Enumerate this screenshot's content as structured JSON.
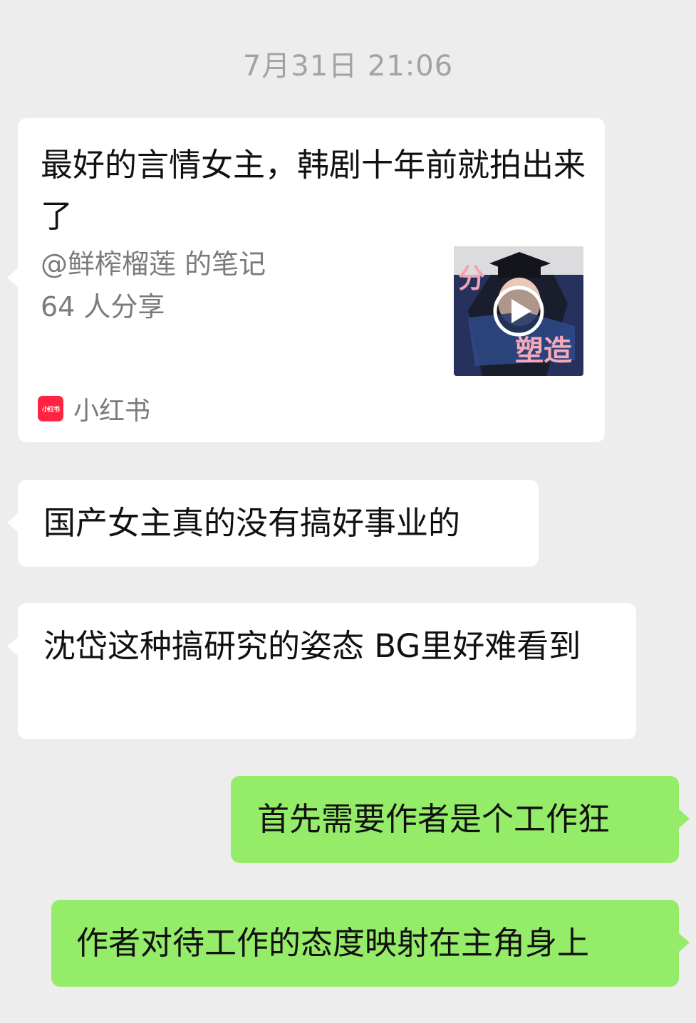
{
  "timestamp": "7月31日 21:06",
  "card": {
    "title": "最好的言情女主，韩剧十年前就拍出来了",
    "author": "@鲜榨榴莲 的笔记",
    "shares": "64 人分享",
    "thumbnail_text": "分 塑造",
    "source_logo_text": "小红书",
    "source_name": "小红书"
  },
  "messages": [
    {
      "side": "left",
      "text": "国产女主真的没有搞好事业的"
    },
    {
      "side": "left",
      "text": "沈岱这种搞研究的姿态 BG里好难看到"
    },
    {
      "side": "right",
      "text": "首先需要作者是个工作狂"
    },
    {
      "side": "right",
      "text": "作者对待工作的态度映射在主角身上"
    }
  ],
  "colors": {
    "background": "#ededed",
    "incoming_bubble": "#ffffff",
    "outgoing_bubble": "#95ec69",
    "app_logo": "#ff2442"
  },
  "icons": {
    "play": "play-icon",
    "logo": "xiaohongshu-logo-icon"
  }
}
